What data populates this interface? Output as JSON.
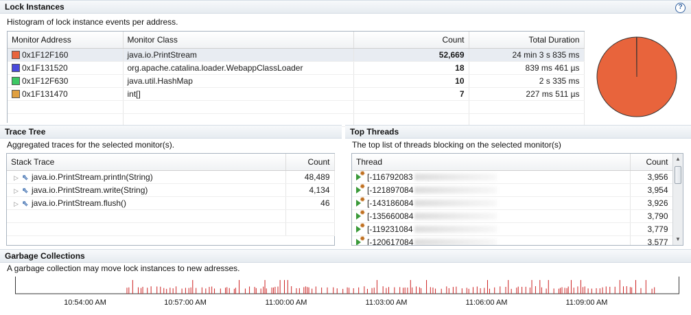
{
  "lock_instances": {
    "title": "Lock Instances",
    "help_label": "?",
    "description": "Histogram of lock instance events per address.",
    "columns": [
      "Monitor Address",
      "Monitor Class",
      "Count",
      "Total Duration"
    ],
    "rows": [
      {
        "color": "#e8643c",
        "address": "0x1F12F160",
        "class": "java.io.PrintStream",
        "count": "52,669",
        "duration": "24 min 3 s 835 ms"
      },
      {
        "color": "#4a4adc",
        "address": "0x1F131520",
        "class": "org.apache.catalina.loader.WebappClassLoader",
        "count": "18",
        "duration": "839 ms 461 µs"
      },
      {
        "color": "#3cc864",
        "address": "0x1F12F630",
        "class": "java.util.HashMap",
        "count": "10",
        "duration": "2 s 335 ms"
      },
      {
        "color": "#e0a040",
        "address": "0x1F131470",
        "class": "int[]",
        "count": "7",
        "duration": "227 ms 511 µs"
      }
    ],
    "pie_slices": [
      {
        "label": "0x1F12F160",
        "value": 52669,
        "color": "#e8643c"
      },
      {
        "label": "0x1F131520",
        "value": 18,
        "color": "#4a4adc"
      },
      {
        "label": "0x1F12F630",
        "value": 10,
        "color": "#3cc864"
      },
      {
        "label": "0x1F131470",
        "value": 7,
        "color": "#e0a040"
      }
    ]
  },
  "trace_tree": {
    "title": "Trace Tree",
    "description": "Aggregated traces for the selected monitor(s).",
    "columns": [
      "Stack Trace",
      "Count"
    ],
    "rows": [
      {
        "frame": "java.io.PrintStream.println(String)",
        "count": "48,489"
      },
      {
        "frame": "java.io.PrintStream.write(String)",
        "count": "4,134"
      },
      {
        "frame": "java.io.PrintStream.flush()",
        "count": "46"
      }
    ]
  },
  "top_threads": {
    "title": "Top Threads",
    "description": "The top list of threads blocking on the selected monitor(s)",
    "columns": [
      "Thread",
      "Count"
    ],
    "rows": [
      {
        "thread": "[-116792083",
        "count": "3,956"
      },
      {
        "thread": "[-121897084",
        "count": "3,954"
      },
      {
        "thread": "[-143186084",
        "count": "3,926"
      },
      {
        "thread": "[-135660084",
        "count": "3,790"
      },
      {
        "thread": "[-119231084",
        "count": "3,779"
      },
      {
        "thread": "[-120617084",
        "count": "3,577"
      }
    ]
  },
  "garbage_collections": {
    "title": "Garbage Collections",
    "description": "A garbage collection may move lock instances to new adresses.",
    "marker_color": "#cc2020",
    "time_labels": [
      "10:54:00 AM",
      "10:57:00 AM",
      "11:00:00 AM",
      "11:03:00 AM",
      "11:06:00 AM",
      "11:09:00 AM"
    ]
  }
}
